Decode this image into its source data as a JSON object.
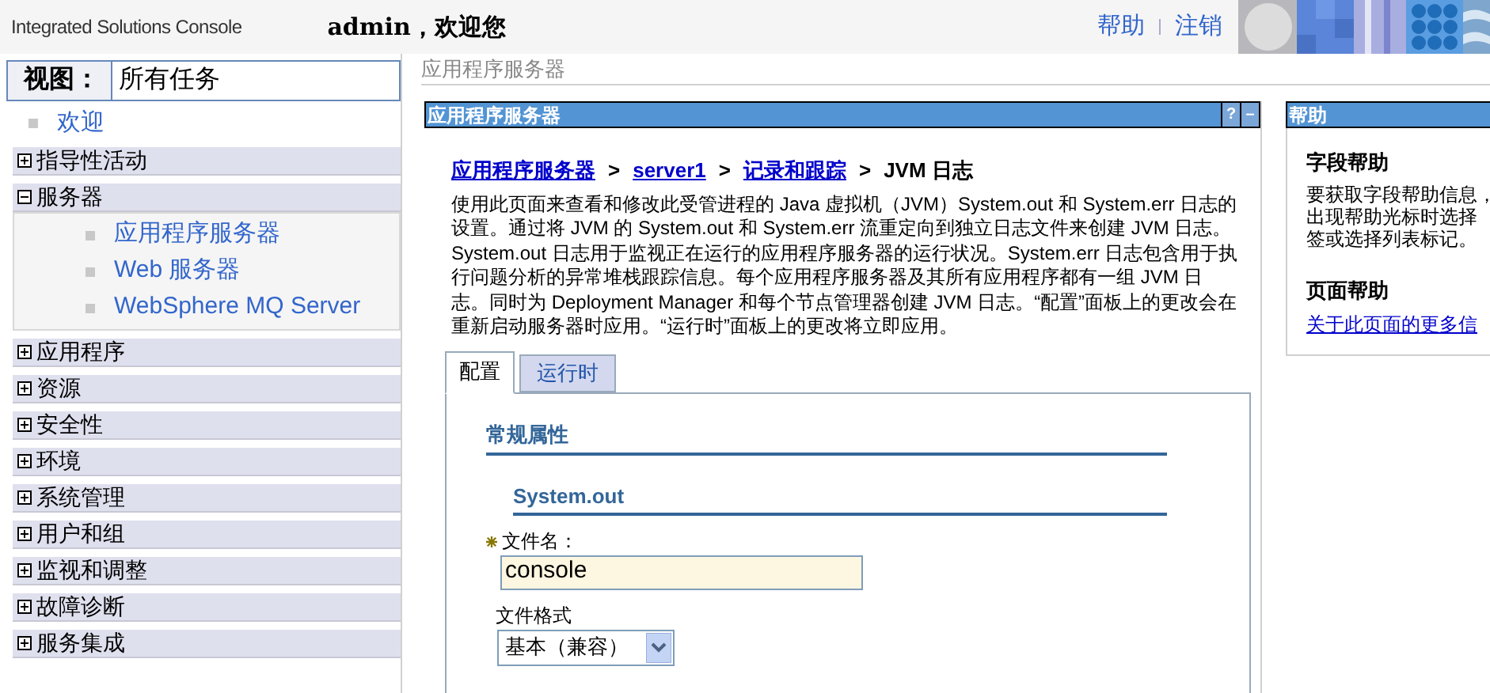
{
  "header": {
    "product": "Integrated Solutions Console",
    "welcome": "admin，欢迎您",
    "links": [
      "帮助",
      "注销"
    ]
  },
  "sidebar": {
    "view_label": "视图：",
    "view_value": "所有任务",
    "welcome_link": "欢迎",
    "items": [
      {
        "label": "指导性活动",
        "expanded": false
      },
      {
        "label": "服务器",
        "expanded": true,
        "children": [
          {
            "label": "应用程序服务器"
          },
          {
            "label": "Web 服务器"
          },
          {
            "label": "WebSphere MQ Server"
          }
        ]
      },
      {
        "label": "应用程序",
        "expanded": false
      },
      {
        "label": "资源",
        "expanded": false
      },
      {
        "label": "安全性",
        "expanded": false
      },
      {
        "label": "环境",
        "expanded": false
      },
      {
        "label": "系统管理",
        "expanded": false
      },
      {
        "label": "用户和组",
        "expanded": false
      },
      {
        "label": "监视和调整",
        "expanded": false
      },
      {
        "label": "故障诊断",
        "expanded": false
      },
      {
        "label": "服务集成",
        "expanded": false
      }
    ]
  },
  "page_title": "应用程序服务器",
  "panel": {
    "title": "应用程序服务器",
    "buttons": [
      "?",
      "–"
    ],
    "breadcrumb": {
      "separator": ">",
      "items": [
        {
          "label": "应用程序服务器",
          "link": true
        },
        {
          "label": "server1",
          "link": true
        },
        {
          "label": "记录和跟踪",
          "link": true
        },
        {
          "label": "JVM 日志",
          "link": false
        }
      ]
    },
    "description": "使用此页面来查看和修改此受管进程的 Java 虚拟机（JVM）System.out 和 System.err 日志的设置。通过将 JVM 的 System.out 和 System.err 流重定向到独立日志文件来创建 JVM 日志。System.out 日志用于监视正在运行的应用程序服务器的运行状况。System.err 日志包含用于执行问题分析的异常堆栈跟踪信息。每个应用程序服务器及其所有应用程序都有一组 JVM 日志。同时为 Deployment Manager 和每个节点管理器创建 JVM 日志。“配置”面板上的更改会在重新启动服务器时应用。“运行时”面板上的更改将立即应用。",
    "tabs": [
      {
        "label": "配置",
        "selected": true
      },
      {
        "label": "运行时",
        "selected": false
      }
    ],
    "section": "常规属性",
    "subsection": "System.out",
    "fields": [
      {
        "kind": "text",
        "label": "文件名：",
        "required": true,
        "value": "console"
      },
      {
        "kind": "select",
        "label": "文件格式",
        "required": false,
        "value": "基本（兼容）"
      }
    ]
  },
  "help": {
    "title": "帮助",
    "sections": [
      {
        "heading": "字段帮助",
        "lines": [
          "要获取字段帮助信息，",
          "出现帮助光标时选择",
          "签或选择列表标记。"
        ]
      },
      {
        "heading": "页面帮助",
        "link": "关于此页面的更多信"
      }
    ]
  }
}
